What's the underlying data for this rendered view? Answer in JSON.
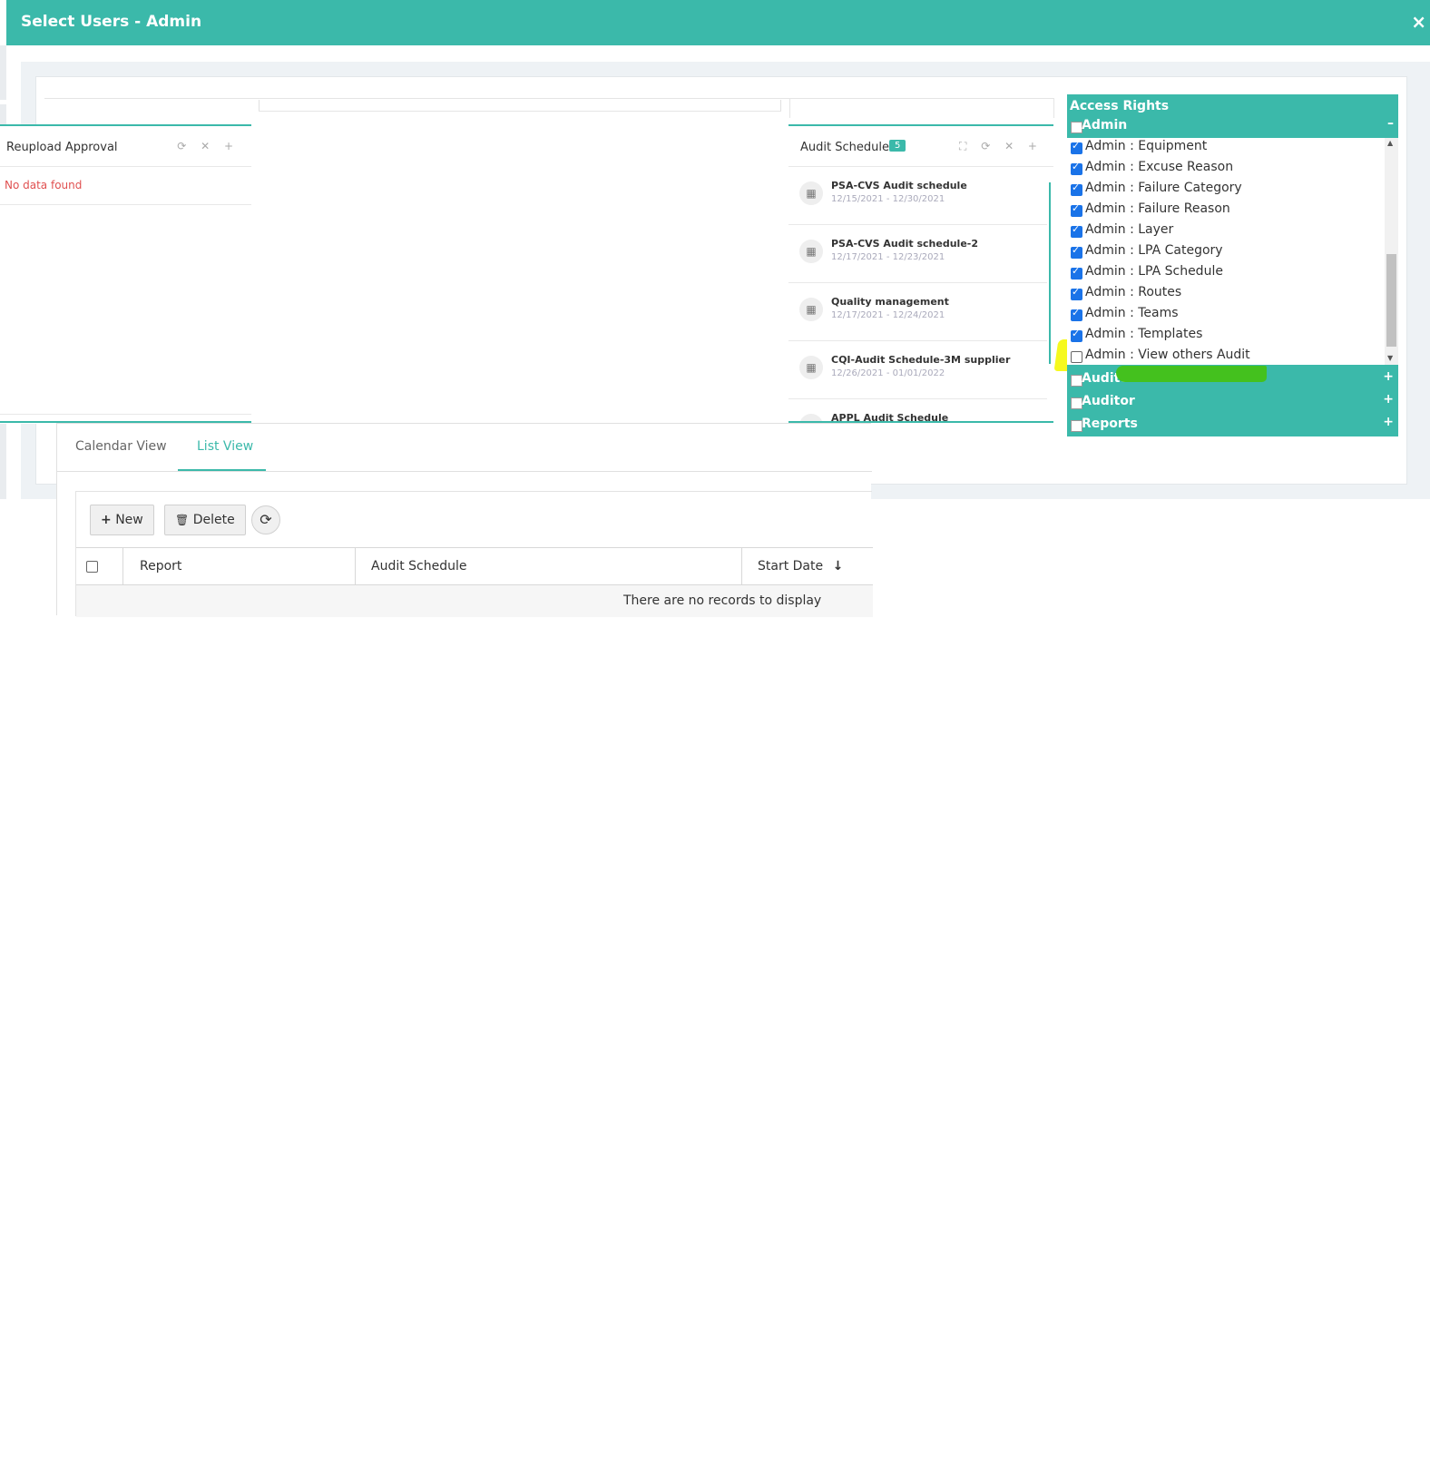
{
  "modal": {
    "title": "Select Users - Admin",
    "close": "×"
  },
  "reupload": {
    "title": "Reupload Approval",
    "icons": "⟳ ✕ +",
    "empty": "No data found"
  },
  "audit_schedule": {
    "title": "Audit Schedule",
    "badge": "5",
    "icons": "⛶ ⟳ ✕ +",
    "items": [
      {
        "name": "PSA-CVS Audit schedule",
        "dates": "12/15/2021 - 12/30/2021"
      },
      {
        "name": "PSA-CVS Audit schedule-2",
        "dates": "12/17/2021 - 12/23/2021"
      },
      {
        "name": "Quality management",
        "dates": "12/17/2021 - 12/24/2021"
      },
      {
        "name": "CQI-Audit Schedule-3M supplier",
        "dates": "12/26/2021 - 01/01/2022"
      },
      {
        "name": "APPL Audit Schedule",
        "dates": ""
      }
    ]
  },
  "access_rights": {
    "title": "Access Rights",
    "groups": {
      "admin": {
        "label": "Admin",
        "toggle": "–"
      },
      "auditee": {
        "label": "Auditee",
        "toggle": "+"
      },
      "auditor": {
        "label": "Auditor",
        "toggle": "+"
      },
      "reports": {
        "label": "Reports",
        "toggle": "+"
      }
    },
    "permissions": [
      {
        "label": "Admin : Equipment",
        "checked": true
      },
      {
        "label": "Admin : Excuse Reason",
        "checked": true
      },
      {
        "label": "Admin : Failure Category",
        "checked": true
      },
      {
        "label": "Admin : Failure Reason",
        "checked": true
      },
      {
        "label": "Admin : Layer",
        "checked": true
      },
      {
        "label": "Admin : LPA Category",
        "checked": true
      },
      {
        "label": "Admin : LPA Schedule",
        "checked": true
      },
      {
        "label": "Admin : Routes",
        "checked": true
      },
      {
        "label": "Admin : Teams",
        "checked": true
      },
      {
        "label": "Admin : Templates",
        "checked": true
      },
      {
        "label": "Admin : View others Audit",
        "checked": false
      }
    ],
    "highlight_colors": {
      "yellow": "#f6f91e",
      "green": "#44c11e"
    }
  },
  "tabs": {
    "calendar": "Calendar View",
    "list": "List View"
  },
  "toolbar": {
    "new_label": "New",
    "new_icon": "+",
    "delete_label": "Delete",
    "delete_icon": "🗑",
    "refresh_icon": "⟳"
  },
  "table": {
    "columns": [
      "Report",
      "Audit Schedule",
      "Start Date"
    ],
    "sort_icon": "↓",
    "empty": "There are no records to display"
  },
  "colors": {
    "accent": "#3bb9aa",
    "checkbox": "#1a73e8",
    "error": "#e05050"
  }
}
